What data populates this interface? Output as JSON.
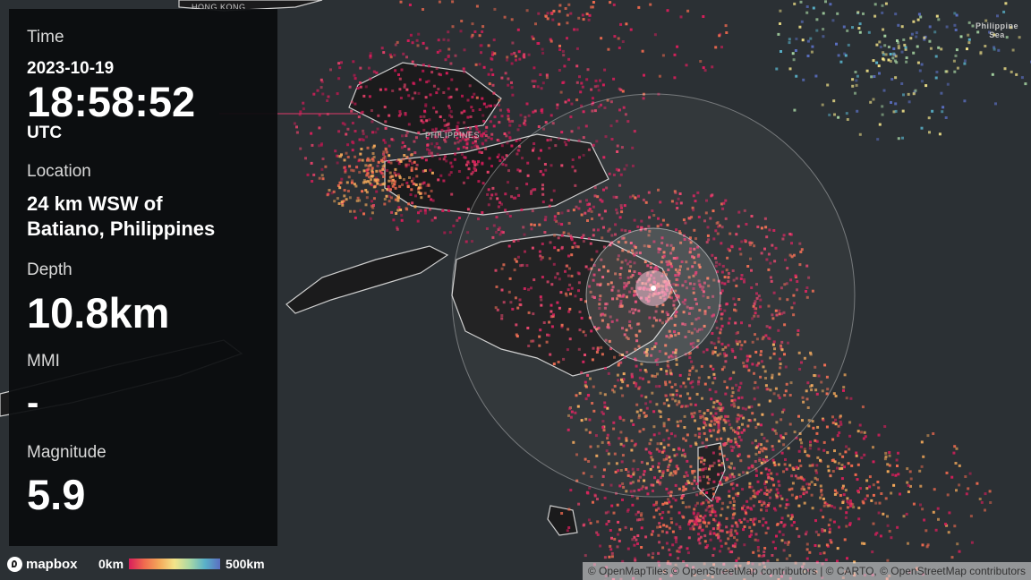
{
  "panel": {
    "time_label": "Time",
    "date": "2023-10-19",
    "time": "18:58:52",
    "timezone": "UTC",
    "location_label": "Location",
    "location_line1": "24 km WSW of",
    "location_line2": "Batiano, Philippines",
    "depth_label": "Depth",
    "depth_value": "10.8km",
    "mmi_label": "MMI",
    "mmi_value": "-",
    "magnitude_label": "Magnitude",
    "magnitude_value": "5.9"
  },
  "legend": {
    "min_label": "0km",
    "max_label": "500km",
    "colors": [
      "#d81e5b",
      "#f06a4f",
      "#f4a95a",
      "#f3e48a",
      "#a9d8a5",
      "#59b1c8",
      "#5b6fc2"
    ]
  },
  "map": {
    "labels": {
      "hong_kong": "HONG KONG",
      "philippines": "PHILIPPINES",
      "philippine_sea_1": "Philippine",
      "philippine_sea_2": "Sea"
    },
    "logo_text": "mapbox",
    "attribution": "© OpenMapTiles © OpenStreetMap contributors | © CARTO, © OpenStreetMap contributors",
    "colors": {
      "water": "#2b3034",
      "land": "#1b1b1c",
      "panel": "#0a0c0e"
    }
  }
}
